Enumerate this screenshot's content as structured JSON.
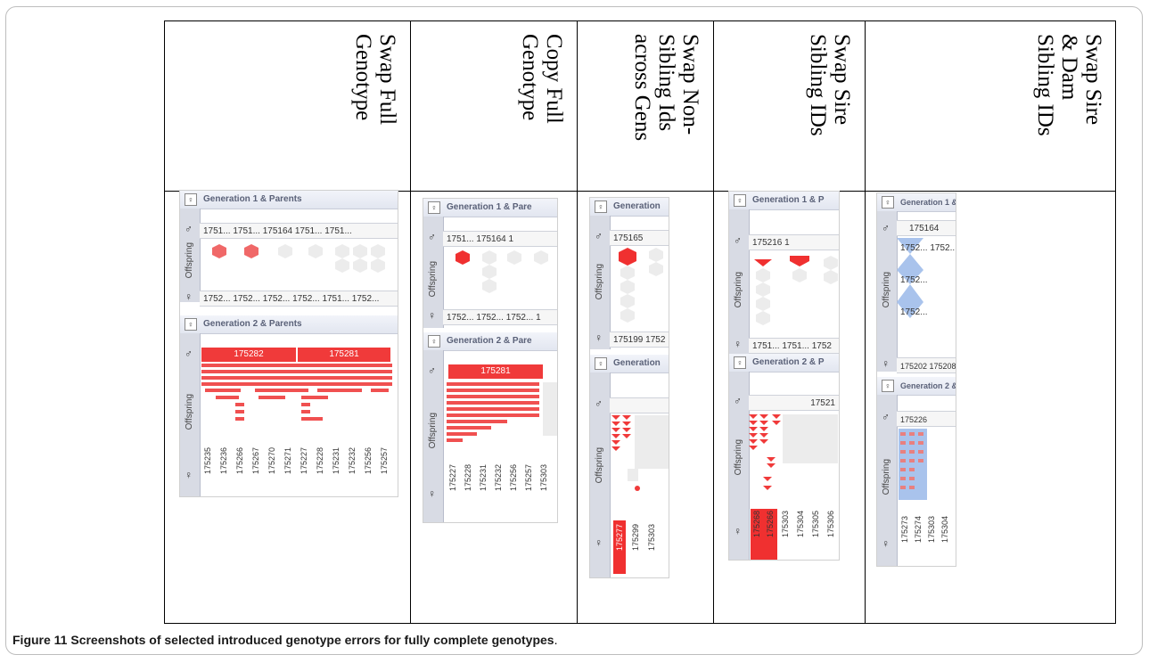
{
  "figure": {
    "caption_bold": "Figure 11 Screenshots of selected introduced genotype errors for fully complete genotypes",
    "caption_end": "."
  },
  "columns": [
    {
      "header": "Swap Full\nGenotype"
    },
    {
      "header": "Copy Full\nGenotype"
    },
    {
      "header": "Swap Non-\nSibling Ids\nacross Gens"
    },
    {
      "header": "Swap Sire\nSibling IDs"
    },
    {
      "header": "Swap Sire\n& Dam\nSibling IDs"
    }
  ],
  "shots": {
    "a": {
      "gen1": "Generation 1 & Parents",
      "gen2": "Generation 2 & Parents",
      "sire_ids": "1751... 1751...    175164    1751... 1751...",
      "dam_ids": "1752... 1752... 1752... 1752... 1751... 1752...",
      "bar1": "175282",
      "bar2": "175281",
      "offspring": "Offspring",
      "vids": [
        "175235",
        "175236",
        "175266",
        "175267",
        "175270",
        "175271",
        "175227",
        "175228",
        "175231",
        "175232",
        "175256",
        "175257"
      ]
    },
    "b": {
      "gen1": "Generation 1 & Pare",
      "gen2": "Generation 2 & Pare",
      "sire_ids": "1751...      175164    1",
      "dam_ids": "1752... 1752... 1752... 1",
      "bar1": "175281",
      "offspring": "Offspring",
      "vids": [
        "175227",
        "175228",
        "175231",
        "175232",
        "175256",
        "175257",
        "175303"
      ]
    },
    "c": {
      "gen1": "Generation",
      "gen2": "Generation",
      "sire_ids": "175165",
      "dam_ids": "175199 1752",
      "offspring": "Offspring",
      "vids": [
        "175277",
        "175299",
        "175303"
      ]
    },
    "d": {
      "gen1": "Generation 1 & P",
      "gen2": "Generation 2 & P",
      "sire_ids": "175216      1",
      "dam_ids": "1751... 1751... 1752",
      "sire2": "17521",
      "offspring": "Offspring",
      "vids": [
        "175268",
        "175266",
        "175303",
        "175304",
        "175305",
        "175306"
      ]
    },
    "e": {
      "gen1": "Generation 1 &",
      "gen2": "Generation 2 &",
      "sire_ids": "175164",
      "mid_ids": "1752... 1752...",
      "mid2": "1752...",
      "mid3": "1752...",
      "dam_ids": "175202 175208 1",
      "sire2": "175226",
      "offspring": "Offspring",
      "vids": [
        "175273",
        "175274",
        "175303",
        "175304"
      ]
    }
  },
  "colors": {
    "error_red": "#f03a3a",
    "highlight_blue": "#a9c3ec",
    "panel_grey": "#d8dbe4"
  }
}
